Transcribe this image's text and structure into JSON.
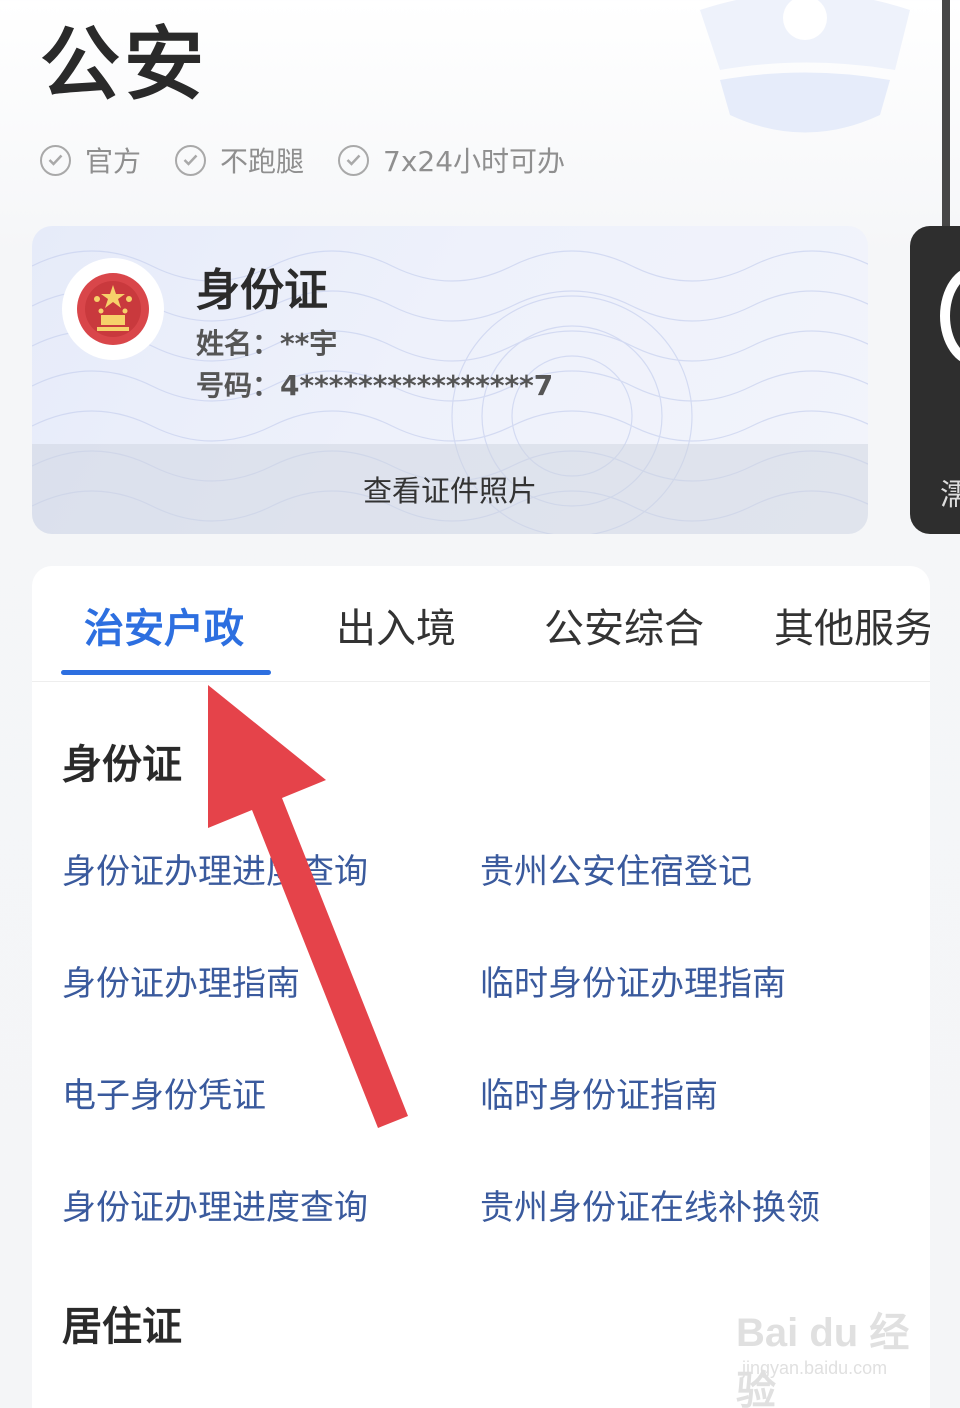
{
  "header": {
    "title": "公安",
    "tags": [
      "官方",
      "不跑腿",
      "7x24小时可办"
    ]
  },
  "id_card": {
    "title": "身份证",
    "name_line": "姓名：**宇",
    "number_line": "号码：4****************7",
    "view_photo_label": "查看证件照片"
  },
  "next_card": {
    "partial_text": "濡"
  },
  "tabs": [
    {
      "label": "治安户政",
      "active": true
    },
    {
      "label": "出入境",
      "active": false
    },
    {
      "label": "公安综合",
      "active": false
    },
    {
      "label": "其他服务",
      "active": false
    }
  ],
  "sections": [
    {
      "title": "身份证",
      "links": [
        "身份证办理进度查询",
        "贵州公安住宿登记",
        "身份证办理指南",
        "临时身份证办理指南",
        "电子身份凭证",
        "临时身份证指南",
        "身份证办理进度查询",
        "贵州身份证在线补换领"
      ]
    },
    {
      "title": "居住证"
    }
  ],
  "watermark": {
    "logo": "Bai du 经验",
    "url": "jingyan.baidu.com"
  },
  "colors": {
    "accent": "#2d6fe0",
    "link": "#3a5a9d",
    "arrow": "#e5434a"
  }
}
